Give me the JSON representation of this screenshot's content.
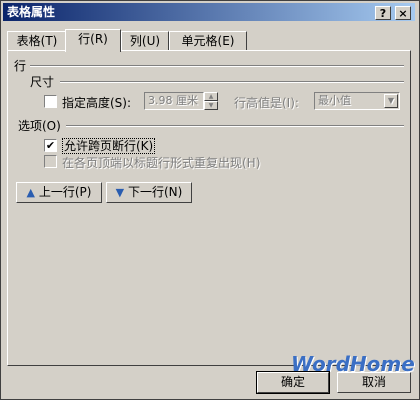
{
  "window": {
    "title": "表格属性",
    "help_btn": "?",
    "close_btn": "×"
  },
  "tabs": [
    {
      "label": "表格(T)"
    },
    {
      "label": "行(R)"
    },
    {
      "label": "列(U)"
    },
    {
      "label": "单元格(E)"
    }
  ],
  "row_panel": {
    "group_label": "行",
    "size_label": "尺寸",
    "specify_height_label": "指定高度(S):",
    "specify_height_checked": false,
    "height_value": "3.98 厘米",
    "height_mode_label": "行高值是(I):",
    "height_mode_value": "最小值",
    "options_label": "选项(O)",
    "allow_break_label": "允许跨页断行(K)",
    "allow_break_checked": true,
    "repeat_header_label": "在各页顶端以标题行形式重复出现(H)",
    "repeat_header_checked": false,
    "prev_row_label": "上一行(P)",
    "next_row_label": "下一行(N)"
  },
  "watermark": "WordHome",
  "footer": {
    "ok_label": "确定",
    "cancel_label": "取消"
  },
  "icons": {
    "up": "arrow-up-icon",
    "down": "arrow-down-icon",
    "check": "✔"
  }
}
